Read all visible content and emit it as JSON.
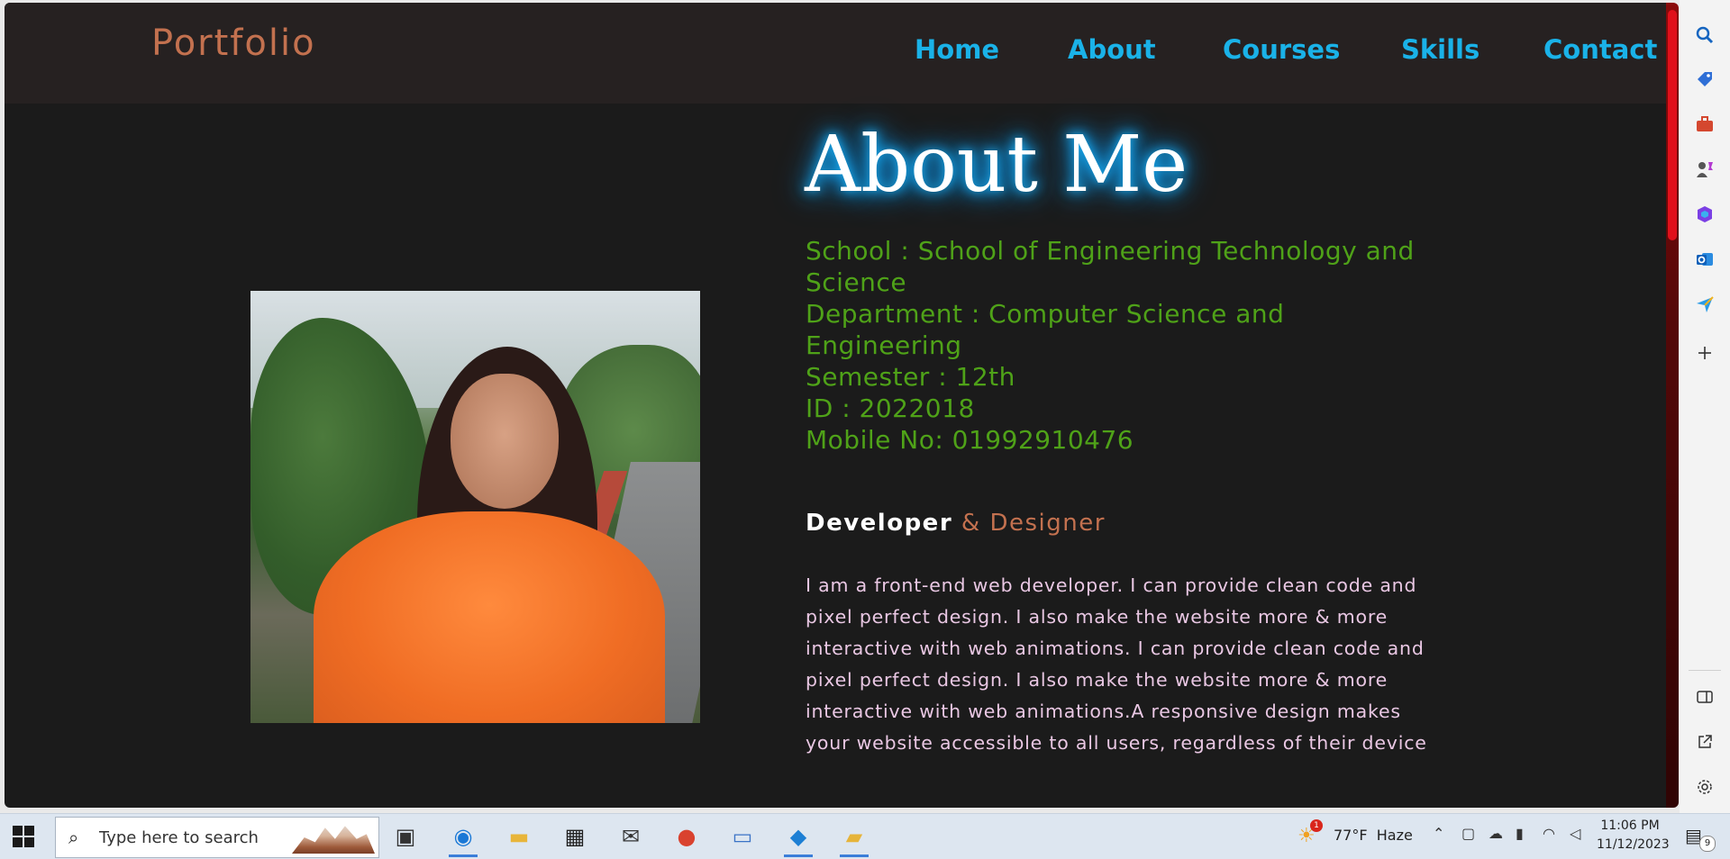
{
  "navbar": {
    "brand": "Portfolio",
    "links": [
      "Home",
      "About",
      "Courses",
      "Skills",
      "Contact"
    ]
  },
  "about": {
    "title": "About Me",
    "info": [
      "School : School of Engineering Technology and Science",
      "Department : Computer Science and Engineering",
      "Semester : 12th",
      "ID : 2022018",
      "Mobile No: 01992910476"
    ],
    "role_primary": "Developer",
    "role_secondary": "& Designer",
    "bio": "I am a front-end web developer. I can provide clean code and pixel perfect design. I also make the website more & more interactive with web animations. I can provide clean code and pixel perfect design. I also make the website more & more interactive with web animations.A responsive design makes your website accessible to all users, regardless of their device"
  },
  "colors": {
    "brand": "#c3714f",
    "nav_link": "#1ab2e8",
    "info_text": "#4fa218",
    "bio_text": "#e9c7e3",
    "page_bg": "#1b1b1b",
    "navbar_bg": "#262121",
    "scrollbar_thumb": "#e0101b"
  },
  "edge_sidebar": {
    "icons": [
      "search-icon",
      "tag-icon",
      "toolbox-icon",
      "games-icon",
      "office-icon",
      "outlook-icon",
      "send-icon",
      "plus-icon",
      "panel-icon",
      "external-link-icon",
      "gear-icon"
    ]
  },
  "taskbar": {
    "search_placeholder": "Type here to search",
    "apps": [
      "task-view",
      "edge",
      "file-explorer",
      "store",
      "mail",
      "chrome",
      "this-pc",
      "vscode",
      "folder"
    ],
    "weather_temp": "77°F",
    "weather_cond": "Haze",
    "weather_badge": "1",
    "time": "11:06 PM",
    "date": "11/12/2023",
    "notification_count": "9"
  }
}
